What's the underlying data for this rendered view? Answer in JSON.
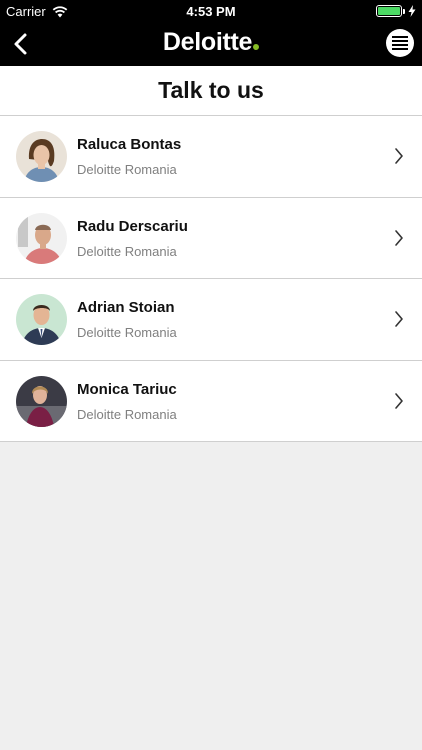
{
  "status": {
    "carrier": "Carrier",
    "time": "4:53 PM",
    "battery_level": 1.0,
    "battery_color": "#4cd964"
  },
  "nav": {
    "logo_text": "Deloitte",
    "logo_dot_color": "#86bc25",
    "back_icon": "chevron-left-icon",
    "menu_icon": "menu-icon"
  },
  "page": {
    "title": "Talk to us"
  },
  "contacts": [
    {
      "name": "Raluca Bontas",
      "company": "Deloitte Romania"
    },
    {
      "name": "Radu Derscariu",
      "company": "Deloitte Romania"
    },
    {
      "name": "Adrian Stoian",
      "company": "Deloitte Romania"
    },
    {
      "name": "Monica Tariuc",
      "company": "Deloitte Romania"
    }
  ]
}
